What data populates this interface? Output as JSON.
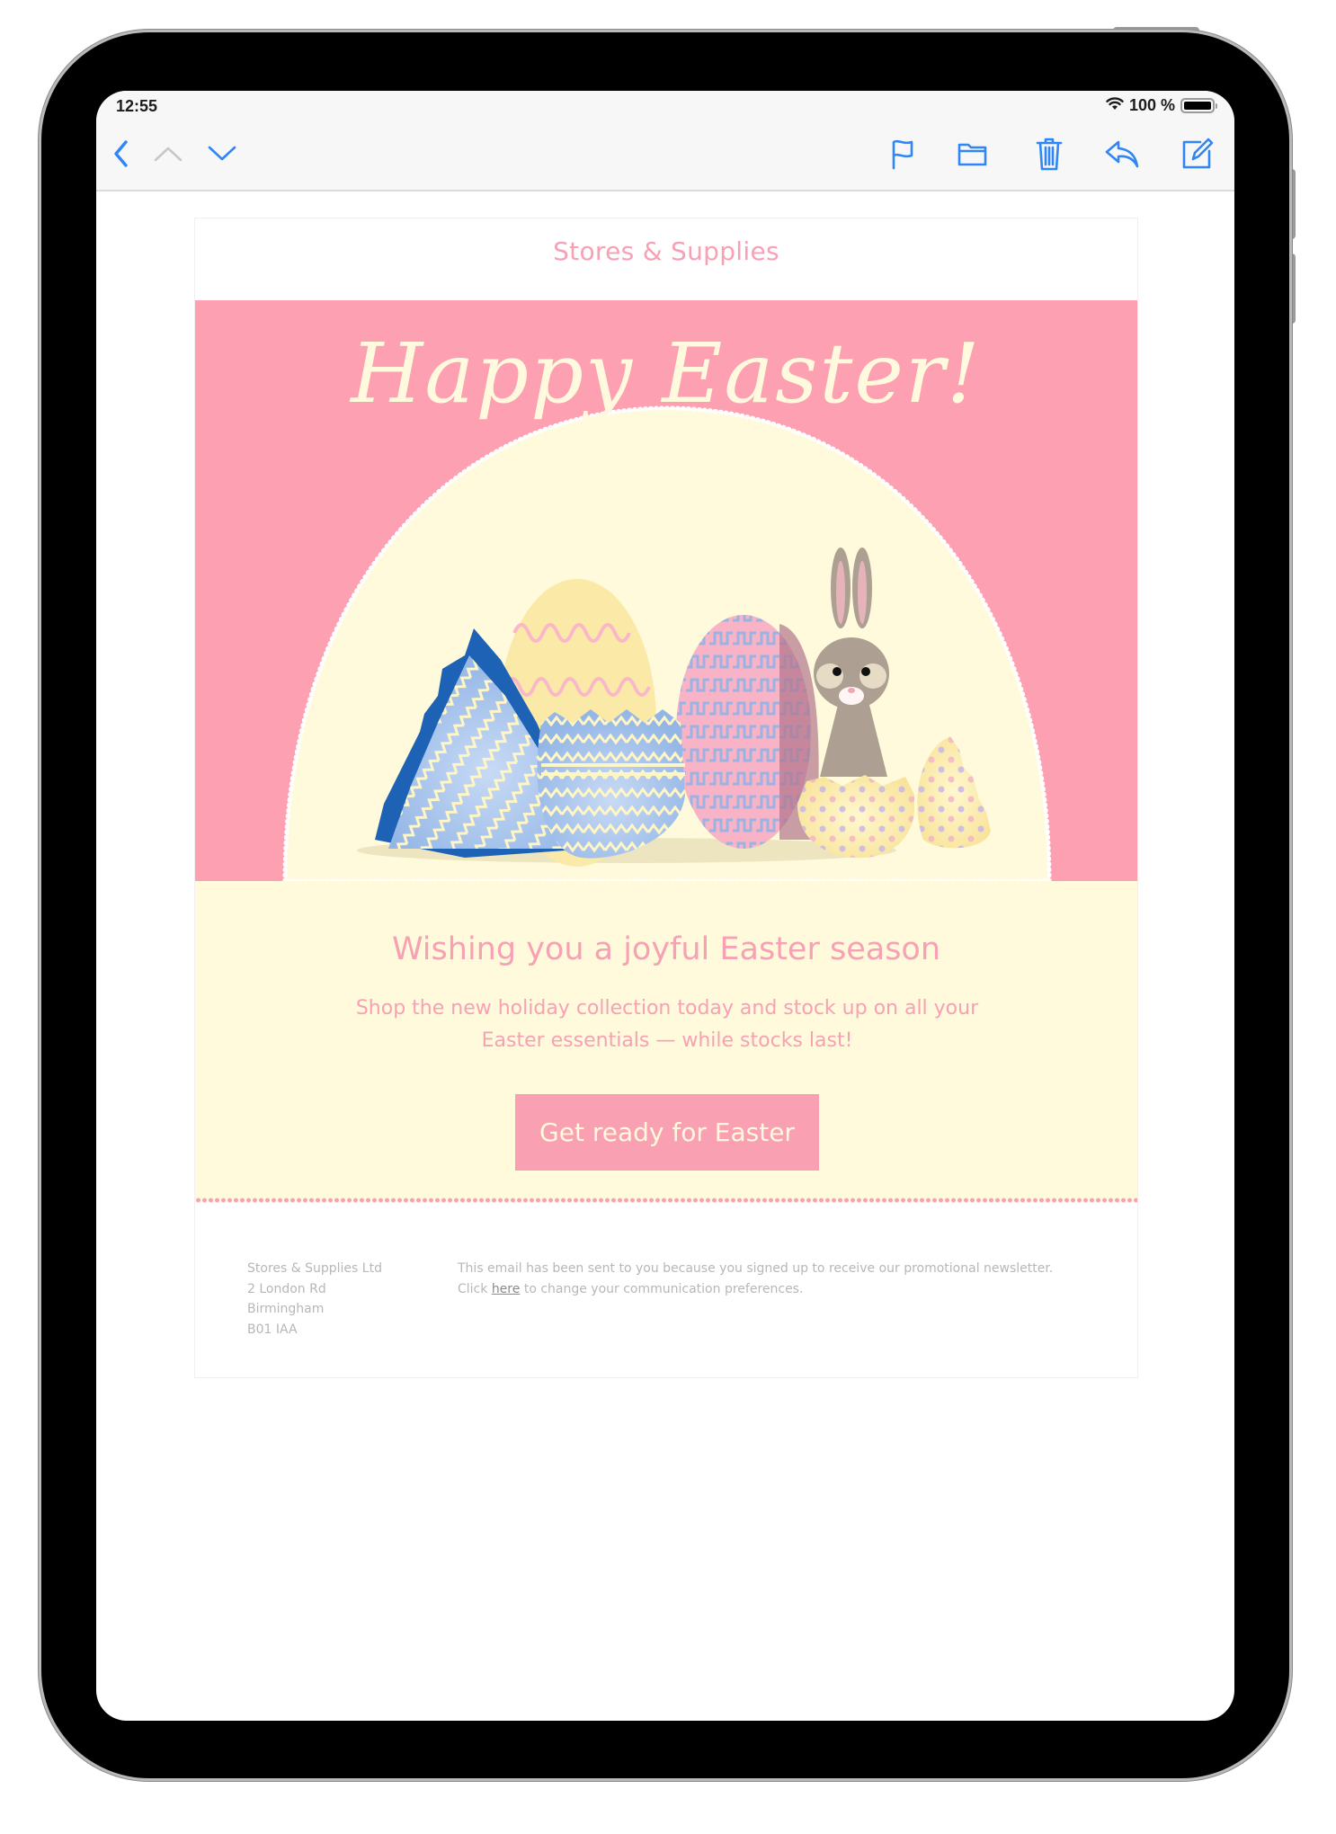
{
  "status_bar": {
    "time": "12:55",
    "battery_text": "100 %",
    "battery_level_percent": 100,
    "icons": [
      "wifi-icon",
      "battery-icon"
    ]
  },
  "toolbar": {
    "left": [
      {
        "name": "back",
        "icon": "chevron-left-icon",
        "enabled": true
      },
      {
        "name": "previous-message",
        "icon": "chevron-up-icon",
        "enabled": false
      },
      {
        "name": "next-message",
        "icon": "chevron-down-icon",
        "enabled": true
      }
    ],
    "right": [
      {
        "name": "flag",
        "icon": "flag-icon"
      },
      {
        "name": "move-to-folder",
        "icon": "folder-icon"
      },
      {
        "name": "trash",
        "icon": "trash-icon"
      },
      {
        "name": "reply",
        "icon": "reply-icon"
      },
      {
        "name": "compose",
        "icon": "compose-icon"
      }
    ],
    "accent_color": "#2f86f6"
  },
  "email": {
    "brand": "Stores & Supplies",
    "hero": {
      "title": "Happy Easter!",
      "illustration": "easter-eggs-and-bunny",
      "background_color": "#fca0b2",
      "arch_color": "#fffadc"
    },
    "headline": "Wishing you a joyful Easter season",
    "subtext": "Shop the new holiday collection today and stock up on all your Easter essentials — while stocks last!",
    "cta_label": "Get ready for Easter",
    "footer": {
      "address": [
        "Stores & Supplies Ltd",
        "2 London Rd",
        "Birmingham",
        "B01 IAA"
      ],
      "notice_line1": "This email has been sent to you because you signed up to receive our promotional newsletter.",
      "notice_prefix": "Click ",
      "notice_link": "here",
      "notice_suffix": " to change your communication preferences."
    },
    "colors": {
      "pink": "#f7a1b4",
      "cream": "#fff9dd",
      "footer_text": "#b7b7b7"
    }
  }
}
